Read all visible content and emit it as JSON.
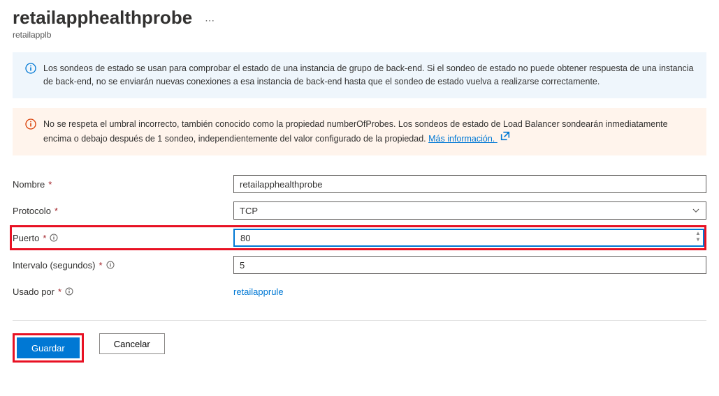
{
  "header": {
    "title": "retailapphealthprobe",
    "subtitle": "retailapplb"
  },
  "alerts": {
    "info": "Los sondeos de estado se usan para comprobar el estado de una instancia de grupo de back-end. Si el sondeo de estado no puede obtener respuesta de una instancia de back-end, no se enviarán nuevas conexiones a esa instancia de back-end hasta que el sondeo de estado vuelva a realizarse correctamente.",
    "warn": "No se respeta el umbral incorrecto, también conocido como la propiedad numberOfProbes. Los sondeos de estado de Load Balancer sondearán inmediatamente encima o debajo después de 1 sondeo, independientemente del valor configurado de la propiedad. ",
    "warn_link": "Más información."
  },
  "form": {
    "name_label": "Nombre",
    "name_value": "retailapphealthprobe",
    "protocol_label": "Protocolo",
    "protocol_value": "TCP",
    "port_label": "Puerto",
    "port_value": "80",
    "interval_label": "Intervalo (segundos)",
    "interval_value": "5",
    "usedby_label": "Usado por",
    "usedby_value": "retailapprule"
  },
  "footer": {
    "save": "Guardar",
    "cancel": "Cancelar"
  }
}
